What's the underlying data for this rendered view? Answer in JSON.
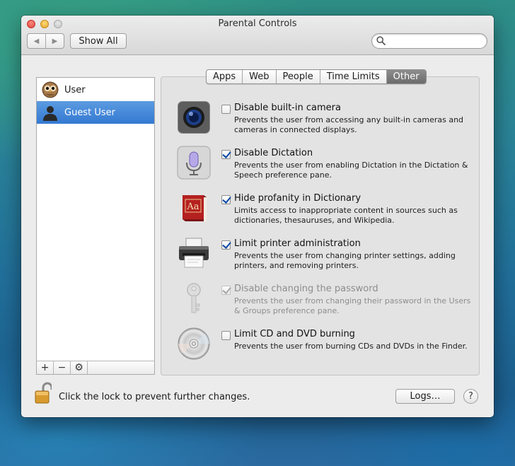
{
  "window": {
    "title": "Parental Controls",
    "show_all_label": "Show All",
    "search_placeholder": "",
    "search_value": ""
  },
  "users": [
    {
      "name": "User",
      "icon": "owl-avatar-icon",
      "selected": false
    },
    {
      "name": "Guest User",
      "icon": "guest-silhouette-icon",
      "selected": true
    }
  ],
  "list_footer": {
    "add": "+",
    "remove": "−",
    "gear": "⚙"
  },
  "tabs": [
    {
      "label": "Apps",
      "active": false
    },
    {
      "label": "Web",
      "active": false
    },
    {
      "label": "People",
      "active": false
    },
    {
      "label": "Time Limits",
      "active": false
    },
    {
      "label": "Other",
      "active": true
    }
  ],
  "options": [
    {
      "label": "Disable built-in camera",
      "desc": "Prevents the user from accessing any built-in cameras and cameras in connected displays.",
      "checked": false,
      "enabled": true,
      "icon": "camera-icon"
    },
    {
      "label": "Disable Dictation",
      "desc": "Prevents the user from enabling Dictation in the Dictation & Speech preference pane.",
      "checked": true,
      "enabled": true,
      "icon": "microphone-icon"
    },
    {
      "label": "Hide profanity in Dictionary",
      "desc": "Limits access to inappropriate content in sources such as dictionaries, thesauruses, and Wikipedia.",
      "checked": true,
      "enabled": true,
      "icon": "dictionary-icon"
    },
    {
      "label": "Limit printer administration",
      "desc": "Prevents the user from changing printer settings, adding printers, and removing printers.",
      "checked": true,
      "enabled": true,
      "icon": "printer-icon"
    },
    {
      "label": "Disable changing the password",
      "desc": "Prevents the user from changing their password in the Users & Groups preference pane.",
      "checked": true,
      "enabled": false,
      "icon": "key-icon"
    },
    {
      "label": "Limit CD and DVD burning",
      "desc": "Prevents the user from burning CDs and DVDs in the Finder.",
      "checked": false,
      "enabled": true,
      "icon": "disc-icon"
    }
  ],
  "footer": {
    "lock_text": "Click the lock to prevent further changes.",
    "logs_label": "Logs…",
    "help_label": "?"
  },
  "colors": {
    "selection": "#3479d2",
    "checkmark": "#0a4aa8"
  }
}
